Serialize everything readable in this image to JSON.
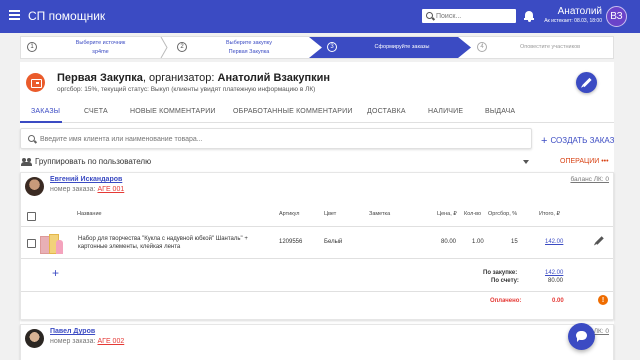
{
  "app": {
    "title": "СП помощник"
  },
  "header": {
    "search_placeholder": "Поиск...",
    "user_name": "Анатолий",
    "user_expiry": "Ак истекает: 08.03, 18:00",
    "avatar_initials": "ВЗ"
  },
  "stepper": [
    {
      "num": "1",
      "line1": "Выберите источник",
      "line2": "sp4me"
    },
    {
      "num": "2",
      "line1": "Выберите закупку",
      "line2": "Первая Закупка"
    },
    {
      "num": "3",
      "line1": "Сформируйте заказы",
      "line2": ""
    },
    {
      "num": "4",
      "line1": "Оповестите участников",
      "line2": ""
    }
  ],
  "purchase": {
    "title_bold": "Первая Закупка",
    "title_mid": ", организатор: ",
    "organizer": "Анатолий Взакупкин",
    "subtitle": "оргсбор: 15%, текущий статус: Выкуп (клиенты увидят платежную информацию в ЛК)"
  },
  "tabs": [
    "ЗАКАЗЫ",
    "СЧЕТА",
    "НОВЫЕ КОММЕНТАРИИ",
    "ОБРАБОТАННЫЕ КОММЕНТАРИИ",
    "ДОСТАВКА",
    "НАЛИЧИЕ",
    "ВЫДАЧА"
  ],
  "client_search": {
    "placeholder": "Введите имя клиента или наименование товара..."
  },
  "create_order": "СОЗДАТЬ ЗАКАЗ",
  "group_by": "Группировать по пользователю",
  "operations": "ОПЕРАЦИИ",
  "table_headers": [
    "Название",
    "Артикул",
    "Цвет",
    "Заметка",
    "Цена, ₽",
    "Кол-во",
    "Оргсбор, %",
    "Итого, ₽"
  ],
  "orders": [
    {
      "client": "Евгений Искандаров",
      "order_label": "номер заказа:",
      "order_code": "АГЕ 001",
      "balance": "баланс ЛК: 0",
      "items": [
        {
          "name": "Набор для творчества \"Кукла с надувной юбкой\" Шанталь\" + картонные элементы, клейкая лента",
          "article": "1209556",
          "color": "Белый",
          "note": "",
          "price": "80.00",
          "qty": "1.00",
          "fee": "15",
          "total": "142.00"
        }
      ],
      "totals": {
        "by_purchase_label": "По закупке:",
        "by_purchase": "142.00",
        "by_invoice_label": "По счету:",
        "by_invoice": "80.00",
        "paid_label": "Оплачено:",
        "paid": "0.00",
        "warn": "!"
      }
    },
    {
      "client": "Павел Дуров",
      "order_label": "номер заказа:",
      "order_code": "АГЕ 002",
      "balance": "баланс ЛК: 0"
    }
  ]
}
